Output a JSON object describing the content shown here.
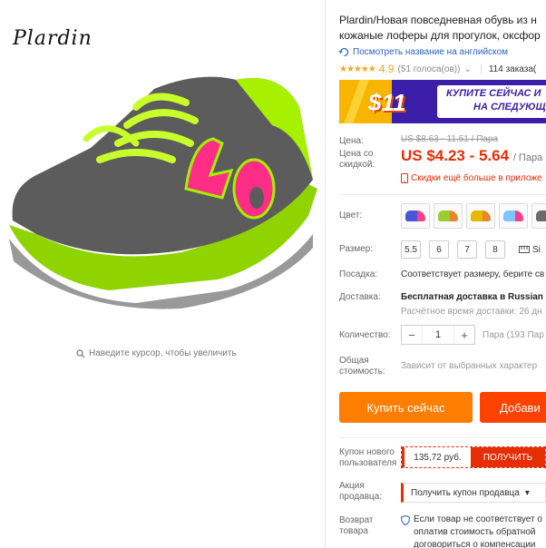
{
  "brand": {
    "logo_text": "Plardin"
  },
  "gallery": {
    "zoom_hint": "Наведите курсор, чтобы увеличить"
  },
  "product": {
    "title_line1": "Plardin/Новая повседневная обувь из н",
    "title_line2": "кожаные лоферы для прогулок, оксфор",
    "translate_link": "Посмотреть название на английском",
    "rating_stars": "★★★★★",
    "rating_value": "4.9",
    "votes": "(51 голоса(ов))",
    "votes_arrow": "⌄",
    "orders": "114 заказа("
  },
  "banner": {
    "price": "$11",
    "line1": "КУПИТЕ СЕЙЧАС И",
    "line2": "НА СЛЕДУЮЩ",
    "colors": {
      "bg": "#3b1fa8",
      "accent": "#f7b500"
    }
  },
  "pricing": {
    "price_label": "Цена:",
    "original_price": "US $8.63 - 11.51 / Пара",
    "discount_label": "Цена со скидкой:",
    "sale_price": "US $4.23 - 5.64",
    "sale_unit": "/ Пара",
    "app_discount": "Скидки ещё больше в приложе"
  },
  "options": {
    "color_label": "Цвет:",
    "colors": [
      {
        "name": "blue-pink",
        "color": "#4a56d6",
        "accent": "#ff3c8a"
      },
      {
        "name": "green-orange",
        "color": "#9acd32",
        "accent": "#e8862a"
      },
      {
        "name": "yellow-orange",
        "color": "#e6b800",
        "accent": "#e8862a"
      },
      {
        "name": "blue-pink-light",
        "color": "#7fc3ff",
        "accent": "#ff3c8a"
      },
      {
        "name": "grey-green",
        "color": "#6a6a6a",
        "accent": "#a6f000"
      }
    ],
    "size_label": "Размер:",
    "sizes": [
      "5.5",
      "6",
      "7",
      "8"
    ],
    "size_chart": "Si",
    "fit_label": "Посадка:",
    "fit_value": "Соответствует размеру, берите св",
    "delivery_label": "Доставка:",
    "delivery_value": "Бесплатная доставка в Russian",
    "delivery_eta": "Расчётное время доставки: 26 дн",
    "qty_label": "Количество:",
    "qty_minus": "−",
    "qty_value": "1",
    "qty_plus": "+",
    "qty_unit": "Пара (193 Пар",
    "total_label": "Общая стоимость:",
    "total_value": "Зависит от выбранных характер"
  },
  "actions": {
    "buy_now": "Купить сейчас",
    "add_to_cart": "Добави"
  },
  "coupons": {
    "new_user_label": "Купон нового пользователя",
    "new_user_amount": "135,72 руб.",
    "get_label": "ПОЛУЧИТЬ",
    "seller_label": "Акция продавца:",
    "seller_select": "Получить купон продавца",
    "return_label": "Возврат товара",
    "return_line1": "Если товар не соответствует о",
    "return_line2": "оплатив стоимость обратной",
    "return_line3": "договориться о компенсации"
  }
}
